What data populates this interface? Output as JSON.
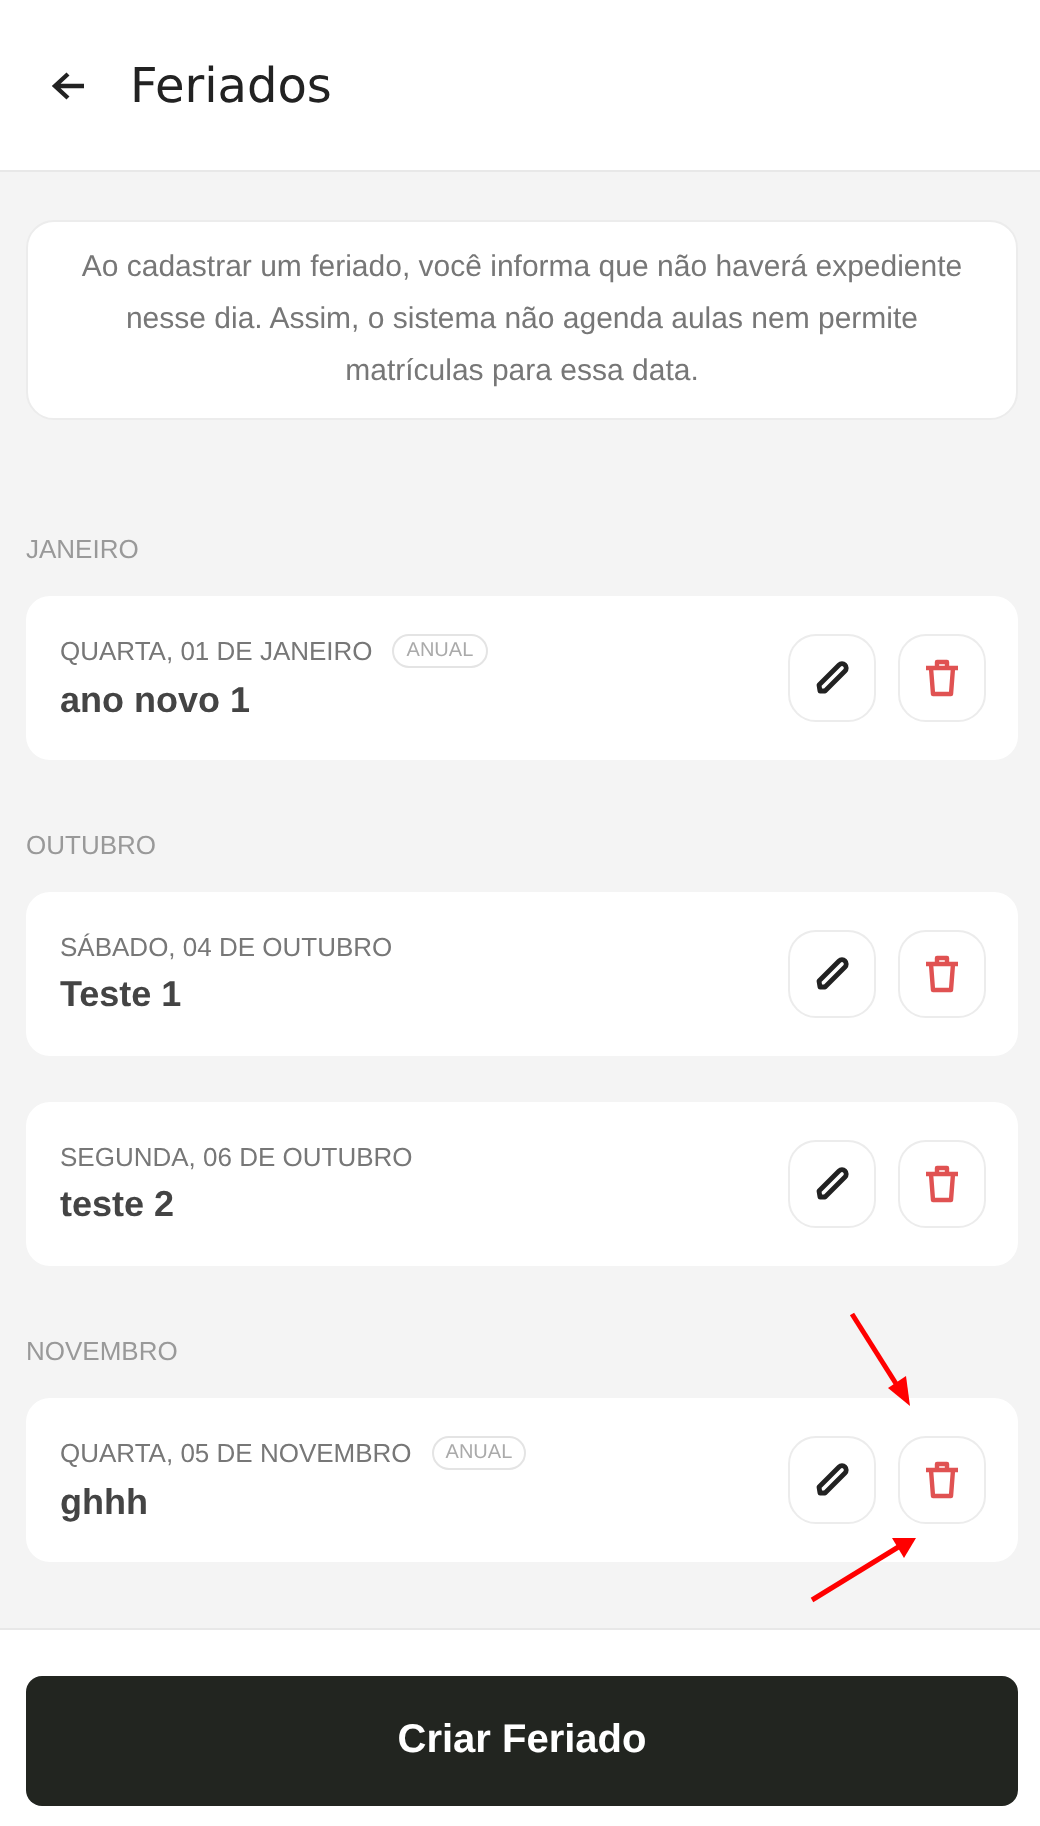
{
  "header": {
    "title": "Feriados"
  },
  "info": "Ao cadastrar um feriado, você informa que não haverá expediente nesse dia. Assim, o sistema não agenda aulas nem permite matrículas para essa data.",
  "sections": [
    {
      "month": "JANEIRO",
      "holidays": [
        {
          "date": "QUARTA, 01 DE JANEIRO",
          "badge": "ANUAL",
          "name": "ano novo 1"
        }
      ]
    },
    {
      "month": "OUTUBRO",
      "holidays": [
        {
          "date": "SÁBADO, 04 DE OUTUBRO",
          "name": "Teste 1"
        },
        {
          "date": "SEGUNDA, 06 DE OUTUBRO",
          "name": "teste 2"
        }
      ]
    },
    {
      "month": "NOVEMBRO",
      "holidays": [
        {
          "date": "QUARTA, 05 DE NOVEMBRO",
          "badge": "ANUAL",
          "name": "ghhh"
        }
      ]
    }
  ],
  "primary_button": "Criar Feriado"
}
